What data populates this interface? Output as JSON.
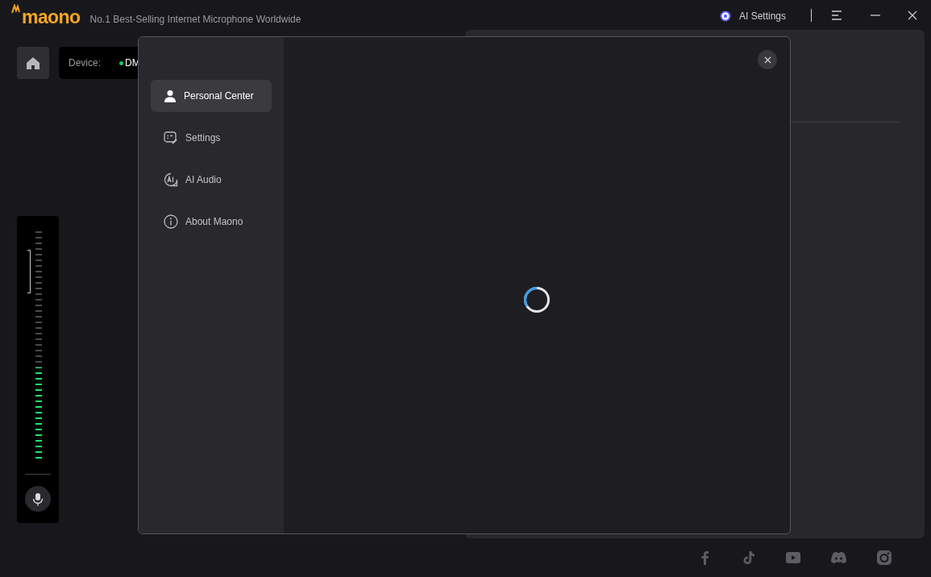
{
  "header": {
    "brand": "maono",
    "tagline": "No.1 Best-Selling Internet Microphone Worldwide",
    "ai_settings": "AI Settings"
  },
  "device": {
    "label": "Device:",
    "name": "DM",
    "connected": true
  },
  "meter": {
    "level": 0.41,
    "muted": false
  },
  "dialog": {
    "menu": [
      {
        "label": "Personal Center",
        "selected": true
      },
      {
        "label": "Settings",
        "selected": false
      },
      {
        "label": "AI Audio",
        "selected": false
      },
      {
        "label": "About Maono",
        "selected": false
      }
    ],
    "loading": true
  }
}
